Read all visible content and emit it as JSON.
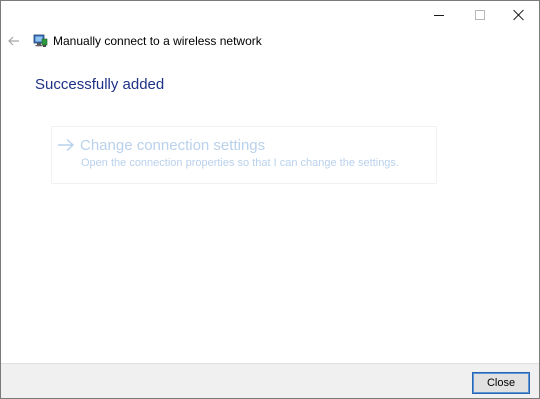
{
  "window": {
    "title_bar": {
      "buttons": [
        "minimize",
        "maximize",
        "close"
      ],
      "icons": [
        "minimize-icon",
        "maximize-icon",
        "close-icon"
      ]
    }
  },
  "header": {
    "back_icon": "back-arrow-icon",
    "app_icon": "wireless-network-icon",
    "title": "Manually connect to a wireless network"
  },
  "main": {
    "heading": "Successfully added",
    "command_link": {
      "icon": "arrow-right-icon",
      "title": "Change connection settings",
      "description": "Open the connection properties so that I can change the settings.",
      "disabled": true
    }
  },
  "footer": {
    "close_label": "Close"
  },
  "colors": {
    "heading": "#1e3287",
    "command_link_text": "#b9d1ec",
    "footer_background": "#f0f0f0",
    "button_focus_border": "#2b66b3"
  }
}
